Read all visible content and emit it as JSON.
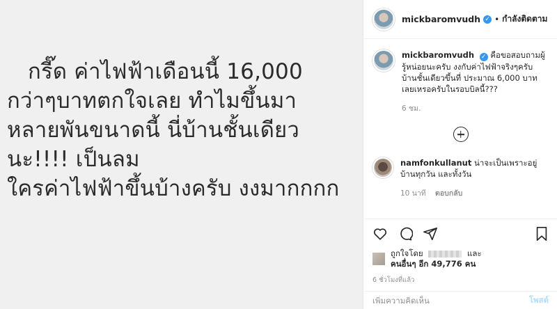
{
  "post": {
    "lines": [
      "กรี๊ด ค่าไฟฟ้าเดือนนี้ 16,000",
      "กว่าๆบาทตกใจเลย  ทำไมขึ้นมา",
      "หลายพันขนาดนี้  นี่บ้านชั้นเดียว",
      "นะ!!!! เป็นลม",
      "ใครค่าไฟฟ้าขึ้นบ้างครับ งงมากกกก"
    ]
  },
  "header": {
    "username": "mickbaromvudh",
    "verified_mark": "✓",
    "separator": "•",
    "follow_state": "กำลังติดตาม"
  },
  "caption": {
    "username": "mickbaromvudh",
    "verified_mark": "✓",
    "text": "คือขอสอบถามผู้รู้หน่อยนะครับ งงกับค่าไฟฟ้าจริงๆครับ บ้านชั้นเดียวขึ้นที่ ประมาณ 6,000 บาทเลยเหรอครับในรอบบิลนี้???",
    "time": "6 ชม."
  },
  "comment1": {
    "username": "namfonkullanut",
    "text": "น่าจะเป็นเพราะอยู่บ้านทุกวัน และทั้งวัน",
    "time": "10 นาที",
    "reply_label": "ตอบกลับ"
  },
  "likes": {
    "prefix": "ถูกใจโดย",
    "and": "และ",
    "others": "คนอื่นๆ อีก 49,776 คน"
  },
  "time_ago": "6 ชั่วโมงที่แล้ว",
  "add_comment": {
    "placeholder": "เพิ่มความคิดเห็น",
    "post_label": "โพสต์"
  },
  "icons": {
    "like": "heart-icon",
    "comment": "comment-icon",
    "share": "share-icon",
    "save": "bookmark-icon",
    "more": "plus-circle-icon"
  }
}
